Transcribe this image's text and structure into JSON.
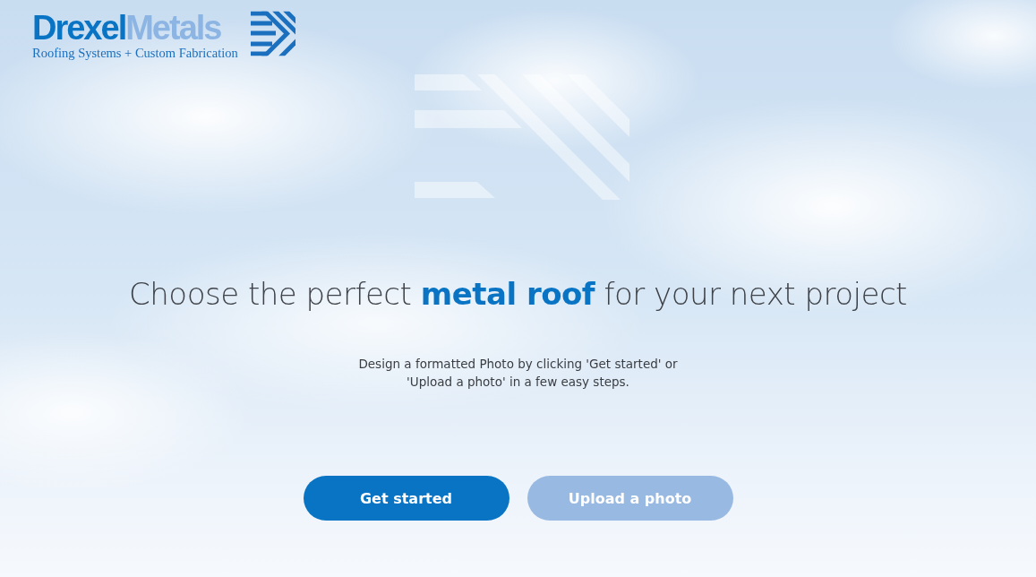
{
  "logo": {
    "word_1": "Drexel",
    "word_2": "Metals",
    "tagline": "Roofing Systems + Custom Fabrication"
  },
  "headline": "Choose the perfect **metal roof** for your next project",
  "description": "Design a formatted Photo by clicking 'Get started' or 'Upload a photo' in a few easy steps.",
  "buttons": [
    {
      "label": "Get started",
      "kind": "primary"
    },
    {
      "label": "Upload a photo",
      "kind": "secondary"
    }
  ]
}
